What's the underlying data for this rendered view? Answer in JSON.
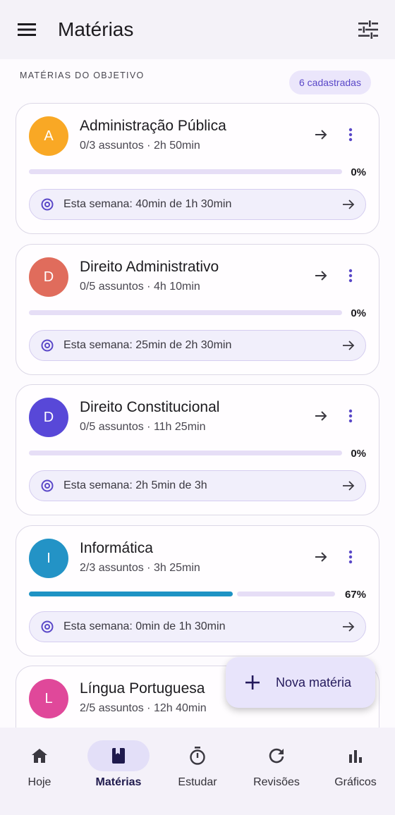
{
  "appbar": {
    "title": "Matérias"
  },
  "section": {
    "header": "MATÉRIAS DO OBJETIVO",
    "count_chip": "6 cadastradas"
  },
  "subjects": [
    {
      "initial": "A",
      "name": "Administração Pública",
      "meta": "0/3 assuntos · 2h 50min",
      "progress_percent": 0,
      "percent_label": "0%",
      "week": "Esta semana: 40min de 1h 30min",
      "color": "#f9a825"
    },
    {
      "initial": "D",
      "name": "Direito Administrativo",
      "meta": "0/5 assuntos · 4h 10min",
      "progress_percent": 0,
      "percent_label": "0%",
      "week": "Esta semana: 25min de 2h 30min",
      "color": "#e06c5c"
    },
    {
      "initial": "D",
      "name": "Direito Constitucional",
      "meta": "0/5 assuntos · 11h 25min",
      "progress_percent": 0,
      "percent_label": "0%",
      "week": "Esta semana: 2h 5min de 3h",
      "color": "#5848d8"
    },
    {
      "initial": "I",
      "name": "Informática",
      "meta": "2/3 assuntos · 3h 25min",
      "progress_percent": 67,
      "percent_label": "67%",
      "week": "Esta semana: 0min de 1h 30min",
      "color": "#2393c6"
    },
    {
      "initial": "L",
      "name": "Língua Portuguesa",
      "meta": "2/5 assuntos · 12h 40min",
      "color": "#e0489a"
    }
  ],
  "fab": {
    "label": "Nova matéria",
    "icon": "plus-icon"
  },
  "nav": [
    {
      "label": "Hoje",
      "icon": "home-icon"
    },
    {
      "label": "Matérias",
      "icon": "book-icon",
      "active": true
    },
    {
      "label": "Estudar",
      "icon": "timer-icon"
    },
    {
      "label": "Revisões",
      "icon": "refresh-icon"
    },
    {
      "label": "Gráficos",
      "icon": "bar-chart-icon"
    }
  ],
  "colors": {
    "accent": "#5a48c8",
    "progress_fill": "#1e93c4",
    "progress_track": "#e6def6"
  }
}
